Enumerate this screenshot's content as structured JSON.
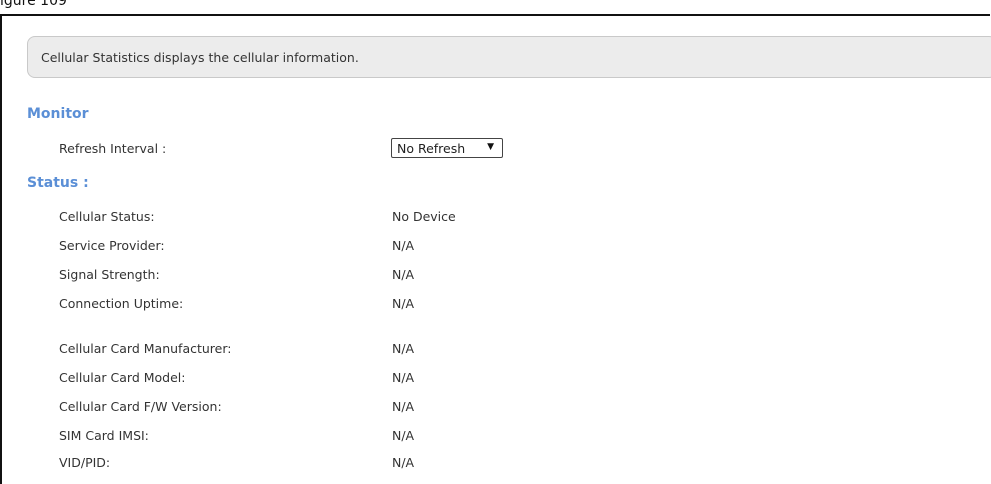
{
  "header_fragment": "igure 109",
  "description": "Cellular Statistics displays the cellular information.",
  "monitor": {
    "title": "Monitor",
    "refresh_label": "Refresh Interval :",
    "refresh_value": "No Refresh"
  },
  "status": {
    "title": "Status :",
    "rows": [
      {
        "label": "Cellular Status:",
        "value": "No Device"
      },
      {
        "label": "Service Provider:",
        "value": "N/A"
      },
      {
        "label": "Signal Strength:",
        "value": "N/A"
      },
      {
        "label": "Connection Uptime:",
        "value": "N/A"
      },
      {
        "label": "Cellular Card Manufacturer:",
        "value": "N/A"
      },
      {
        "label": "Cellular Card Model:",
        "value": "N/A"
      },
      {
        "label": "Cellular Card F/W Version:",
        "value": "N/A"
      },
      {
        "label": "SIM Card IMSI:",
        "value": "N/A"
      },
      {
        "label": "VID/PID:",
        "value": "N/A"
      }
    ]
  },
  "icons": {
    "dropdown": "chevron-down-icon"
  },
  "colors": {
    "section_title": "#5b8fd6",
    "description_background": "#ececec",
    "text": "#333333"
  }
}
